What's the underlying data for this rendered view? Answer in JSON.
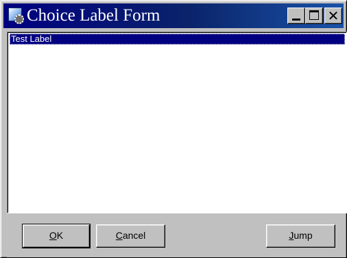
{
  "window": {
    "title": "Choice Label Form",
    "icon": "form-gear-icon",
    "controls": {
      "minimize": "minimize-icon",
      "maximize": "maximize-icon",
      "close": "close-icon",
      "close_glyph": "✕"
    }
  },
  "list": {
    "items": [
      {
        "label": "Test Label",
        "selected": true
      }
    ]
  },
  "buttons": {
    "ok": {
      "accel": "O",
      "rest": "K"
    },
    "cancel": {
      "accel": "C",
      "rest": "ancel"
    },
    "jump": {
      "accel": "J",
      "rest": "ump"
    }
  },
  "colors": {
    "title_bar": "#000080",
    "face": "#c0c0c0",
    "selection": "#000080"
  }
}
